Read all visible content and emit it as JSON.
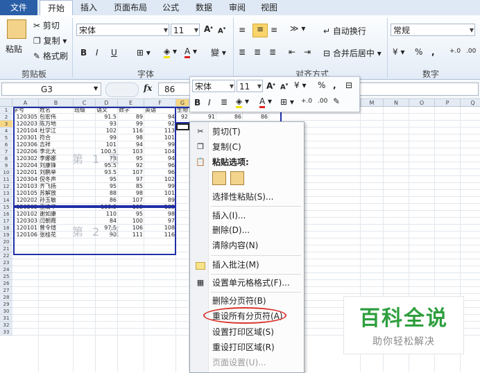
{
  "ribbon_tabs": [
    "文件",
    "开始",
    "插入",
    "页面布局",
    "公式",
    "数据",
    "审阅",
    "视图"
  ],
  "clipboard": {
    "paste": "粘贴",
    "cut": "剪切",
    "copy": "复制",
    "format_painter": "格式刷",
    "group": "剪贴板"
  },
  "font": {
    "name": "宋体",
    "size": "11",
    "group": "字体",
    "bold": "B",
    "italic": "I",
    "underline": "U",
    "font_color_glyph": "A",
    "wen": "變"
  },
  "alignment": {
    "wrap": "自动换行",
    "merge": "合并后居中",
    "group": "对齐方式"
  },
  "number": {
    "format": "常规",
    "group": "数字",
    "percent": "%",
    "comma": ","
  },
  "name_box": "G3",
  "fx": "fx",
  "formula_value": "86",
  "mini_toolbar": {
    "font": "宋体",
    "size": "11",
    "percent": "%",
    "comma": ","
  },
  "grid": {
    "col_headers": [
      "A",
      "B",
      "C",
      "D",
      "E",
      "F",
      "G",
      "",
      "",
      "",
      "",
      "",
      "M",
      "N",
      "O",
      "P",
      "Q"
    ],
    "header_row": [
      "学号",
      "姓名",
      "班级",
      "语文",
      "数学",
      "英语",
      "生物"
    ],
    "rows": [
      [
        "120305",
        "包宏伟",
        "",
        "91.5",
        "89",
        "94"
      ],
      [
        "120203",
        "陈万地",
        "",
        "93",
        "99",
        "92"
      ],
      [
        "120104",
        "杜学江",
        "",
        "102",
        "116",
        "113"
      ],
      [
        "120301",
        "符合",
        "",
        "99",
        "98",
        "101"
      ],
      [
        "120306",
        "吉祥",
        "",
        "101",
        "94",
        "99"
      ],
      [
        "120206",
        "李北大",
        "",
        "100.5",
        "103",
        "104"
      ],
      [
        "120302",
        "李娜娜",
        "",
        "78",
        "95",
        "94"
      ],
      [
        "120204",
        "刘康锋",
        "",
        "95.5",
        "92",
        "96"
      ],
      [
        "120201",
        "刘鹏举",
        "",
        "93.5",
        "107",
        "96"
      ],
      [
        "120304",
        "倪冬声",
        "",
        "95",
        "97",
        "102"
      ],
      [
        "120103",
        "齐飞扬",
        "",
        "95",
        "85",
        "99"
      ],
      [
        "120105",
        "苏解放",
        "",
        "88",
        "98",
        "101"
      ],
      [
        "120202",
        "孙玉敏",
        "",
        "86",
        "107",
        "89"
      ],
      [
        "120205",
        "王清华",
        "",
        "103.5",
        "105",
        "105"
      ],
      [
        "120102",
        "谢如康",
        "",
        "110",
        "95",
        "98"
      ],
      [
        "120303",
        "闫朝霞",
        "",
        "84",
        "100",
        "97"
      ],
      [
        "120101",
        "曾令煊",
        "",
        "97.5",
        "106",
        "108"
      ],
      [
        "120106",
        "张桂花",
        "",
        "90",
        "111",
        "116"
      ]
    ],
    "extra_row2": [
      "92",
      "91",
      "86",
      "86"
    ],
    "page1": "第 1 页",
    "page2": "第 2 页",
    "row_numbers": [
      "1",
      "2",
      "3",
      "4",
      "5",
      "6",
      "7",
      "8",
      "9",
      "10",
      "11",
      "12",
      "13",
      "14",
      "15",
      "16",
      "17",
      "18",
      "19",
      "20",
      "21",
      "22",
      "23",
      "24",
      "25",
      "26",
      "27",
      "28",
      "29",
      "30",
      "31",
      "32",
      "33"
    ]
  },
  "context_menu": {
    "cut": "剪切(T)",
    "copy": "复制(C)",
    "paste_options": "粘贴选项:",
    "paste_special": "选择性粘贴(S)...",
    "insert": "插入(I)...",
    "delete": "删除(D)...",
    "clear": "清除内容(N)",
    "insert_comment": "插入批注(M)",
    "format_cells": "设置单元格格式(F)...",
    "remove_page_break": "删除分页符(B)",
    "reset_all_page_breaks": "重设所有分页符(A)",
    "set_print_area": "设置打印区域(S)",
    "reset_print_area": "重设打印区域(R)",
    "page_setup": "页面设置(U)..."
  },
  "watermark": {
    "title": "百科全说",
    "subtitle": "助你轻松解决"
  },
  "colors": {
    "file_tab": "#2a5fa8",
    "page_break": "#1f2fa6",
    "highlight_oval": "#d9342b",
    "watermark_green": "#2e9e3e"
  }
}
